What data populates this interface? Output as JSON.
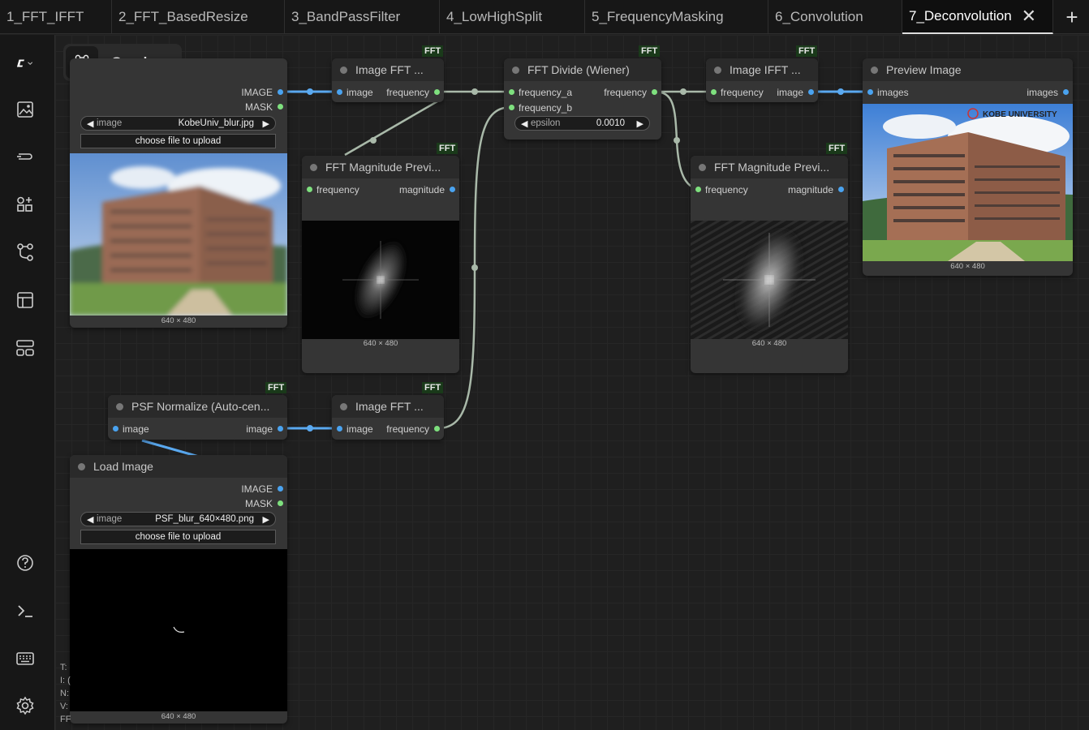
{
  "tabs": [
    {
      "label": "1_FFT_IFFT"
    },
    {
      "label": "2_FFT_BasedResize"
    },
    {
      "label": "3_BandPassFilter"
    },
    {
      "label": "4_LowHighSplit"
    },
    {
      "label": "5_FrequencyMasking"
    },
    {
      "label": "6_Convolution"
    },
    {
      "label": "7_Deconvolution",
      "active": true
    }
  ],
  "graph_label": "Graph",
  "badge_text": "FFT",
  "nodes": {
    "load_top": {
      "out_image": "IMAGE",
      "out_mask": "MASK",
      "widget_label": "image",
      "widget_value": "KobeUniv_blur.jpg",
      "upload_label": "choose file to upload",
      "dims": "640 × 480"
    },
    "fft_top": {
      "title": "Image FFT ...",
      "in": "image",
      "out": "frequency"
    },
    "mag_left": {
      "title": "FFT Magnitude Previ...",
      "in": "frequency",
      "out": "magnitude",
      "dims": "640 × 480"
    },
    "divide": {
      "title": "FFT Divide (Wiener)",
      "in_a": "frequency_a",
      "in_b": "frequency_b",
      "out": "frequency",
      "widget_label": "epsilon",
      "widget_value": "0.0010"
    },
    "ifft": {
      "title": "Image IFFT ...",
      "in": "frequency",
      "out": "image"
    },
    "mag_right": {
      "title": "FFT Magnitude Previ...",
      "in": "frequency",
      "out": "magnitude",
      "dims": "640 × 480"
    },
    "preview": {
      "title": "Preview Image",
      "in": "images",
      "out": "images",
      "dims": "640 × 480",
      "logo_text": "KOBE UNIVERSITY"
    },
    "psf_norm": {
      "title": "PSF Normalize (Auto-cen...",
      "in": "image",
      "out": "image"
    },
    "fft_bottom": {
      "title": "Image FFT ...",
      "in": "image",
      "out": "frequency"
    },
    "load_bottom": {
      "title": "Load Image",
      "out_image": "IMAGE",
      "out_mask": "MASK",
      "widget_label": "image",
      "widget_value": "PSF_blur_640×480.png",
      "upload_label": "choose file to upload",
      "dims": "640 × 480"
    }
  },
  "status_lines": [
    "T:",
    "I: (",
    "N:",
    "V:",
    "FF"
  ],
  "colors": {
    "image_slot": "#4aa3f0",
    "frequency_slot": "#7ee07e",
    "image_wire": "#5aa9f0",
    "frequency_wire": "#a9b9a9"
  }
}
